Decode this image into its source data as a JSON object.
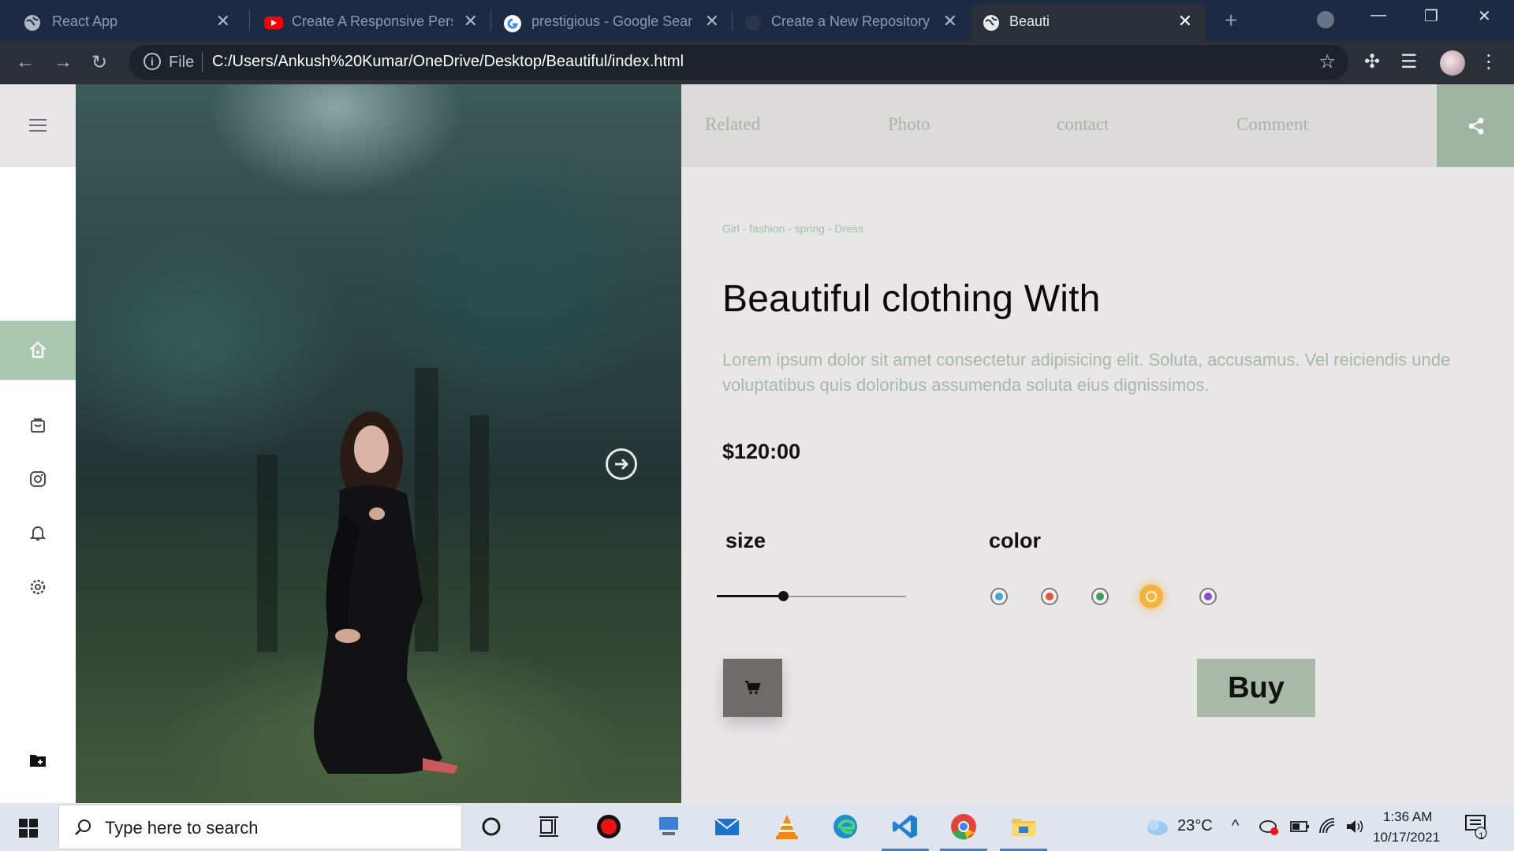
{
  "browser": {
    "tabs": [
      {
        "title": "React App",
        "icon": "globe-icon",
        "close": "✕"
      },
      {
        "title": "Create A Responsive Perso",
        "icon": "youtube-icon",
        "close": "✕"
      },
      {
        "title": "prestigious - Google Sear",
        "icon": "google-icon",
        "close": "✕"
      },
      {
        "title": "Create a New Repository",
        "icon": "github-icon",
        "close": "✕"
      },
      {
        "title": "Beauti",
        "icon": "globe-icon",
        "close": "✕",
        "active": true
      }
    ],
    "new_tab": "+",
    "window_controls": {
      "minimize": "—",
      "restore": "❐",
      "close": "✕"
    },
    "address": {
      "scheme_label": "File",
      "url": "C:/Users/Ankush%20Kumar/OneDrive/Desktop/Beautiful/index.html"
    }
  },
  "page": {
    "nav_links": [
      "Related",
      "Photo",
      "contact",
      "Comment"
    ],
    "breadcrumb": "Girl - fashion - spring - Dress",
    "title": "Beautiful clothing With",
    "description": "Lorem ipsum dolor sit amet consectetur adipisicing elit. Soluta, accusamus. Vel reiciendis unde voluptatibus quis doloribus assumenda soluta eius dignissimos.",
    "price": "$120:00",
    "size_label": "size",
    "size_value": 0.35,
    "color_label": "color",
    "colors": [
      {
        "hex": "#3fa7d6",
        "selected": false
      },
      {
        "hex": "#e2553f",
        "selected": false
      },
      {
        "hex": "#3f9e5b",
        "selected": false
      },
      {
        "hex": "#f6b23a",
        "selected": true
      },
      {
        "hex": "#8a4fe0",
        "selected": false
      }
    ],
    "buy_label": "Buy",
    "accent": "#a8c8b0"
  },
  "sidebar": {
    "icons": [
      "menu-icon",
      "home-icon",
      "shopping-bag-icon",
      "instagram-icon",
      "bell-icon",
      "settings-icon",
      "folder-icon"
    ]
  },
  "taskbar": {
    "search_placeholder": "Type here to search",
    "weather": "23°C",
    "time": "1:36 AM",
    "date": "10/17/2021",
    "notification_count": "1"
  }
}
